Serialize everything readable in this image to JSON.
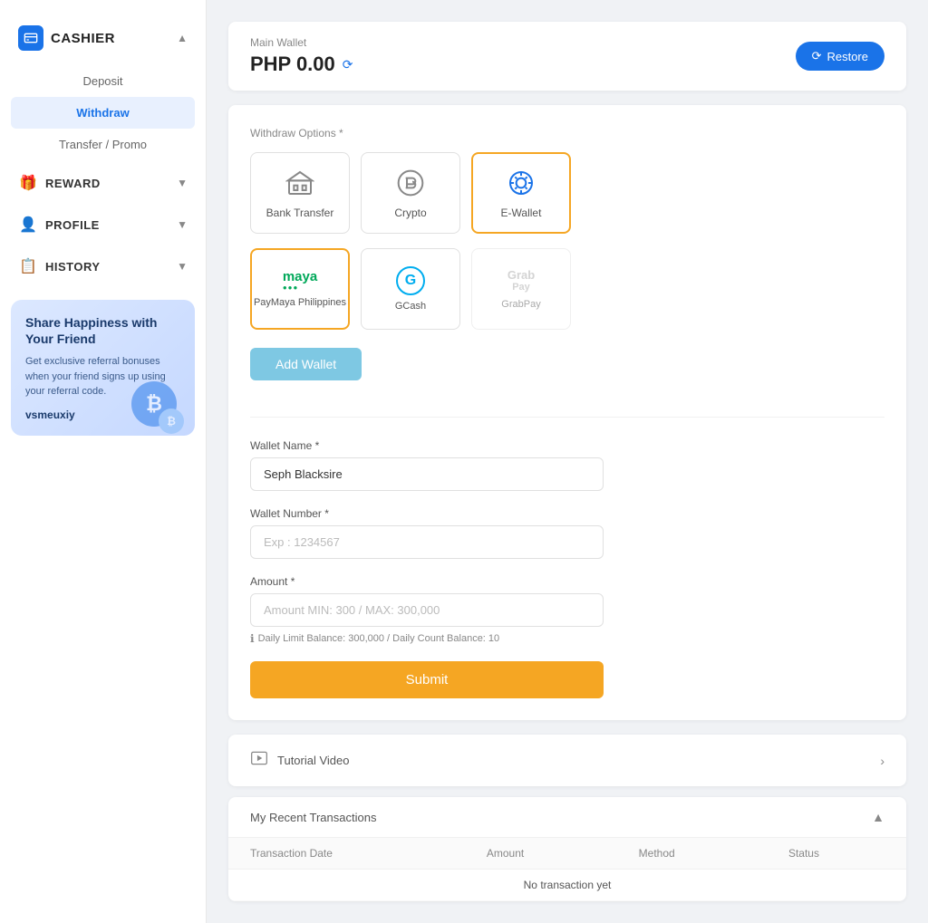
{
  "sidebar": {
    "cashier": {
      "label": "CASHIER",
      "icon": "💳"
    },
    "nav": [
      {
        "id": "deposit",
        "label": "Deposit",
        "active": false
      },
      {
        "id": "withdraw",
        "label": "Withdraw",
        "active": true
      },
      {
        "id": "transfer",
        "label": "Transfer / Promo",
        "active": false
      }
    ],
    "sections": [
      {
        "id": "reward",
        "label": "REWARD",
        "icon": "🎁"
      },
      {
        "id": "profile",
        "label": "PROFILE",
        "icon": "👤"
      },
      {
        "id": "history",
        "label": "HISTORY",
        "icon": "📋"
      }
    ],
    "referral": {
      "title": "Share Happiness with Your Friend",
      "description": "Get exclusive referral bonuses when your friend signs up using your referral code.",
      "code": "vsmeuxiy"
    }
  },
  "wallet_header": {
    "label": "Main Wallet",
    "balance": "PHP 0.00",
    "restore_button": "Restore"
  },
  "withdraw_options": {
    "section_title": "Withdraw Options *",
    "options": [
      {
        "id": "bank_transfer",
        "label": "Bank Transfer",
        "icon": "bank",
        "selected": false
      },
      {
        "id": "crypto",
        "label": "Crypto",
        "icon": "crypto",
        "selected": false
      },
      {
        "id": "ewallet",
        "label": "E-Wallet",
        "icon": "ewallet",
        "selected": true
      }
    ],
    "sub_options": [
      {
        "id": "paymaya",
        "label": "PayMaya Philippines",
        "selected": true,
        "disabled": false
      },
      {
        "id": "gcash",
        "label": "GCash",
        "selected": false,
        "disabled": false
      },
      {
        "id": "grabpay",
        "label": "GrabPay",
        "selected": false,
        "disabled": true
      }
    ],
    "add_wallet_button": "Add Wallet"
  },
  "form": {
    "wallet_name_label": "Wallet Name *",
    "wallet_name_value": "Seph Blacksire",
    "wallet_name_placeholder": "",
    "wallet_number_label": "Wallet Number *",
    "wallet_number_placeholder": "Exp : 1234567",
    "amount_label": "Amount *",
    "amount_placeholder": "Amount MIN: 300 / MAX: 300,000",
    "info_text": "Daily Limit Balance: 300,000 / Daily Count Balance: 10",
    "submit_button": "Submit"
  },
  "tutorial": {
    "label": "Tutorial Video"
  },
  "transactions": {
    "title": "My Recent Transactions",
    "columns": [
      "Transaction Date",
      "Amount",
      "Method",
      "Status"
    ],
    "empty_text": "No transaction yet"
  }
}
